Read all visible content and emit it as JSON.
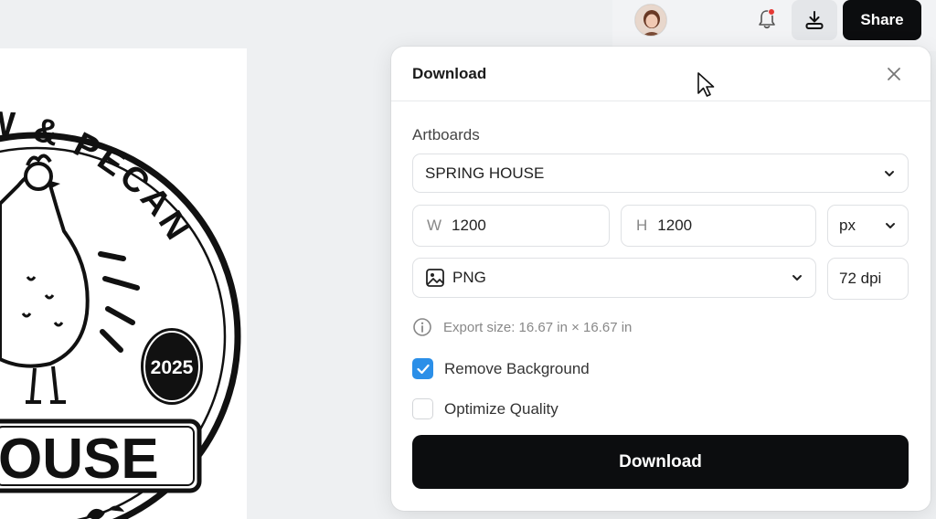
{
  "topbar": {
    "share_label": "Share",
    "avatar_icon": "user-avatar",
    "bell_icon": "bell-icon",
    "download_icon": "download-icon",
    "notification_color": "#e53935"
  },
  "artboard": {
    "text_top": "W & PECAN",
    "badge_year": "2025",
    "banner_text": "OUSE"
  },
  "modal": {
    "title": "Download",
    "close_icon": "close-icon",
    "artboards_label": "Artboards",
    "artboard_value": "SPRING HOUSE",
    "width_prefix": "W",
    "width_value": "1200",
    "height_prefix": "H",
    "height_value": "1200",
    "unit_value": "px",
    "format_value": "PNG",
    "dpi_value": "72 dpi",
    "export_size": "Export size: 16.67 in × 16.67 in",
    "remove_bg_label": "Remove Background",
    "remove_bg_checked": true,
    "optimize_label": "Optimize Quality",
    "optimize_checked": false,
    "download_button": "Download"
  },
  "colors": {
    "accent": "#2b8fe8",
    "primary_button": "#0c0d0f"
  }
}
